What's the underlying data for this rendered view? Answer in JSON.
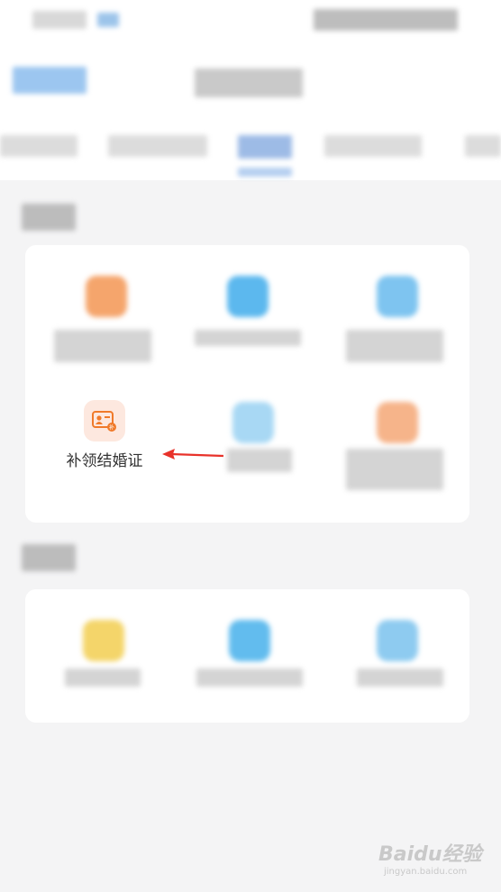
{
  "item": {
    "label": "补领结婚证",
    "icon": "marriage-certificate-icon",
    "accent": "#f07a2a"
  },
  "watermark": {
    "brand": "Baidu经验",
    "url": "jingyan.baidu.com"
  }
}
